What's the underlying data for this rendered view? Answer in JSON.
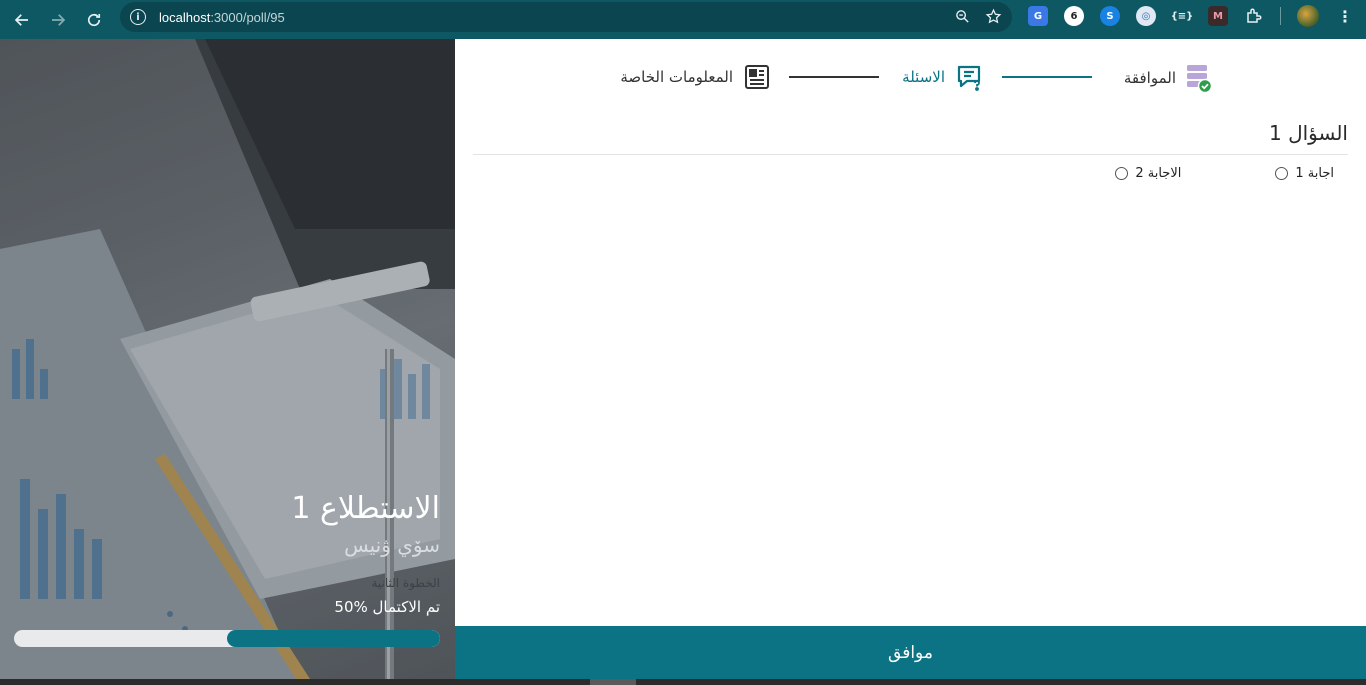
{
  "browser": {
    "url_host": "localhost",
    "url_path": ":3000/poll/95"
  },
  "colors": {
    "accent": "#0b7384",
    "chrome": "#0e5864",
    "success": "#2e9e4a"
  },
  "sidebar": {
    "poll_title": "الاستطلاع 1",
    "poll_subtitle": "سۆي ۋنيس",
    "step_label": "الخطوة الثانية",
    "progress_text": "50% تم الاكتمال",
    "progress_fraction": 0.5
  },
  "stepper": {
    "steps": [
      {
        "label": "الموافقة",
        "icon": "database-check-icon",
        "state": "done"
      },
      {
        "label": "الاسئلة",
        "icon": "chat-question-icon",
        "state": "active"
      },
      {
        "label": "المعلومات الخاصة",
        "icon": "newspaper-icon",
        "state": "pending"
      }
    ]
  },
  "question": {
    "title": "السؤال 1",
    "answers": [
      "اجابة 1",
      "الاجابة 2"
    ]
  },
  "footer": {
    "agree_label": "موافق"
  }
}
